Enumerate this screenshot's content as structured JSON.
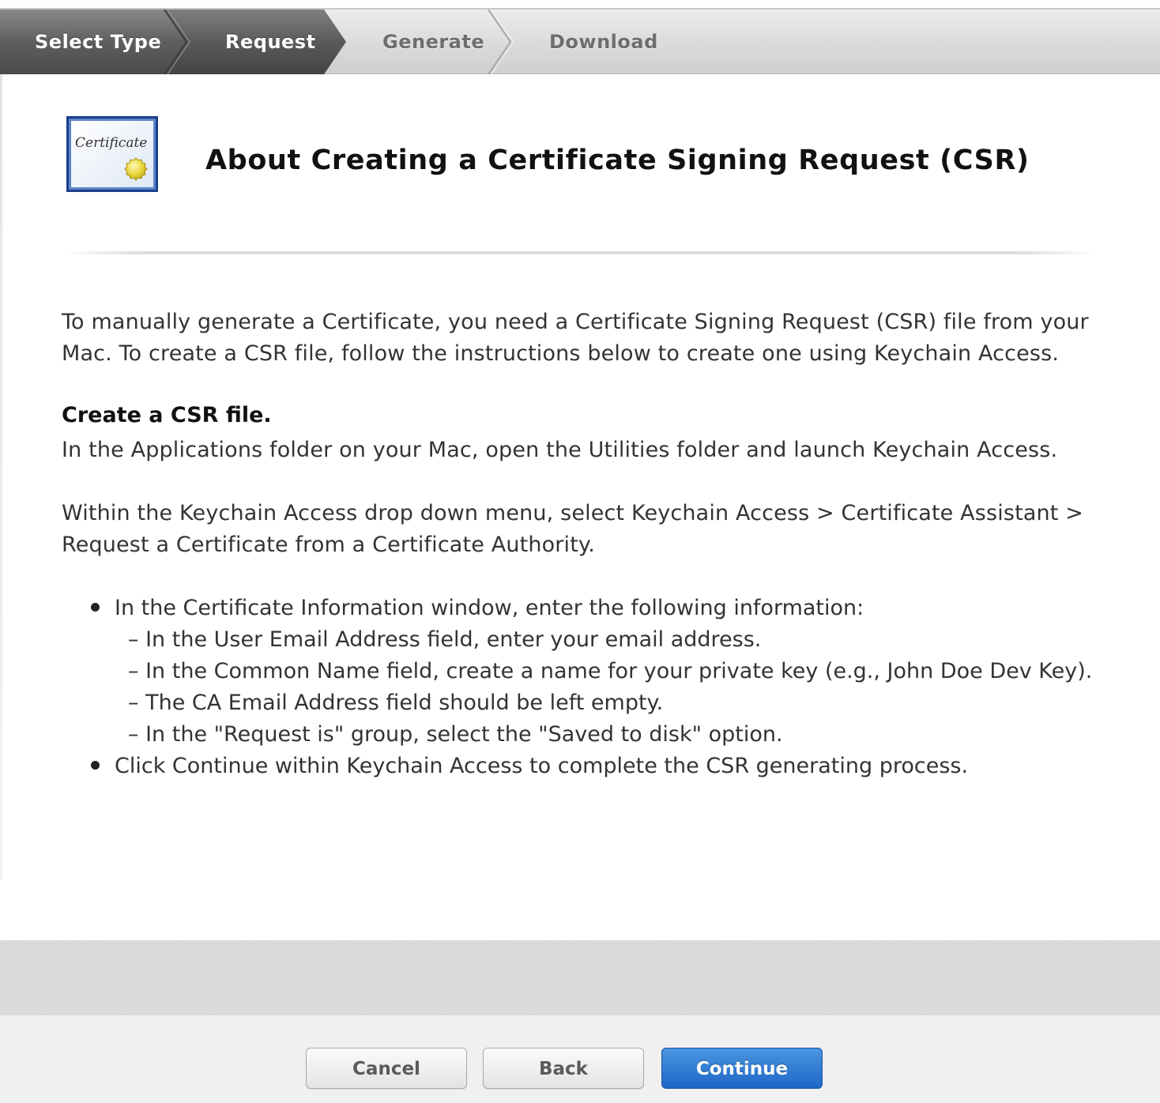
{
  "steps": [
    {
      "label": "Select Type",
      "state": "completed"
    },
    {
      "label": "Request",
      "state": "current"
    },
    {
      "label": "Generate",
      "state": "upcoming"
    },
    {
      "label": "Download",
      "state": "upcoming"
    }
  ],
  "header": {
    "icon": "certificate-icon",
    "icon_text": "Certificate",
    "title": "About Creating a Certificate Signing Request (CSR)"
  },
  "content": {
    "intro": "To manually generate a Certificate, you need a Certificate Signing Request (CSR) file from your Mac. To create a CSR file, follow the instructions below to create one using Keychain Access.",
    "section_heading": "Create a CSR file.",
    "step1": "In the Applications folder on your Mac, open the Utilities folder and launch Keychain Access.",
    "step2": "Within the Keychain Access drop down menu, select Keychain Access > Certificate Assistant > Request a Certificate from a Certificate Authority.",
    "bullets": [
      {
        "text": "In the Certificate Information window, enter the following information:",
        "sub": [
          "– In the User Email Address field, enter your email address.",
          "– In the Common Name field, create a name for your private key (e.g., John Doe Dev Key).",
          "– The CA Email Address field should be left empty.",
          "– In the \"Request is\" group, select the \"Saved to disk\" option."
        ]
      },
      {
        "text": "Click Continue within Keychain Access to complete the CSR generating process.",
        "sub": []
      }
    ]
  },
  "footer": {
    "cancel_label": "Cancel",
    "back_label": "Back",
    "continue_label": "Continue"
  },
  "colors": {
    "step_done": "#5a5a5a",
    "step_upcoming": "#d3d3d3",
    "primary_button": "#1f67c7"
  }
}
